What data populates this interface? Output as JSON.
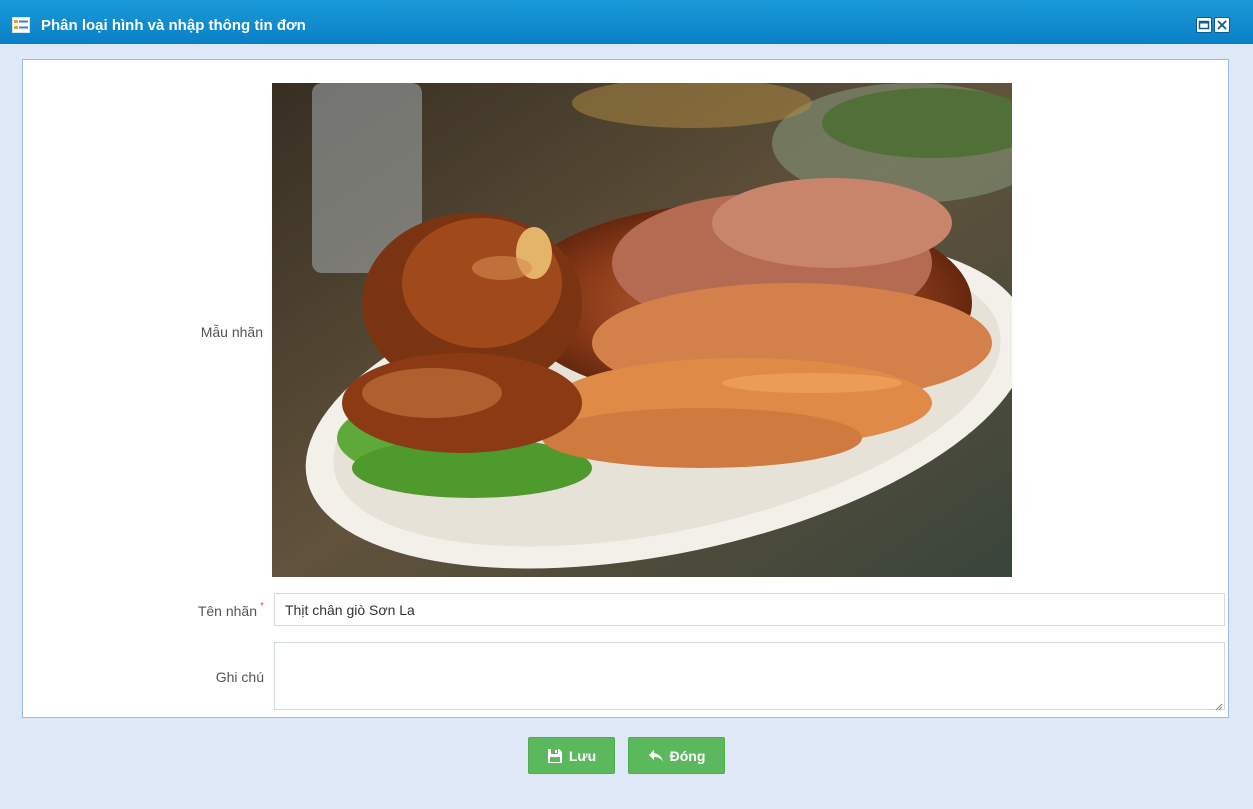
{
  "window": {
    "title": "Phân loại hình và nhập thông tin đơn",
    "icons": {
      "app": "form-list-icon",
      "restore": "restore-window-icon",
      "close": "close-x-icon"
    }
  },
  "form": {
    "sample_label": "Mẫu nhãn",
    "name_label": "Tên nhãn",
    "required_mark": "*",
    "name_value": "Thịt chân giò Sơn La",
    "note_label": "Ghi chú",
    "note_value": ""
  },
  "buttons": {
    "save_label": "Lưu",
    "close_label": "Đóng",
    "save_icon": "floppy-disk-icon",
    "close_icon": "back-arrow-icon"
  },
  "colors": {
    "titlebar": "#0a7fc6",
    "button": "#5cb85c",
    "required": "#d9534f"
  }
}
